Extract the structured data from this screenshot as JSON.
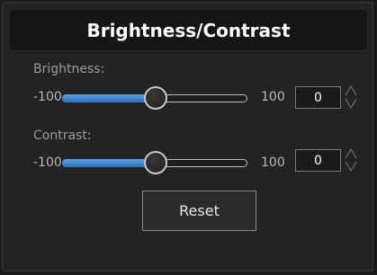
{
  "dialog": {
    "title": "Brightness/Contrast"
  },
  "brightness": {
    "label": "Brightness:",
    "min_label": "-100",
    "max_label": "100",
    "value": "0",
    "slider_fraction": 0.5
  },
  "contrast": {
    "label": "Contrast:",
    "min_label": "-100",
    "max_label": "100",
    "value": "0",
    "slider_fraction": 0.5
  },
  "actions": {
    "reset_label": "Reset"
  },
  "colors": {
    "accent": "#3b82d0",
    "background": "#232323",
    "title_bar": "#151515"
  },
  "icons": {
    "spinner": "up-down-arrows-icon"
  }
}
